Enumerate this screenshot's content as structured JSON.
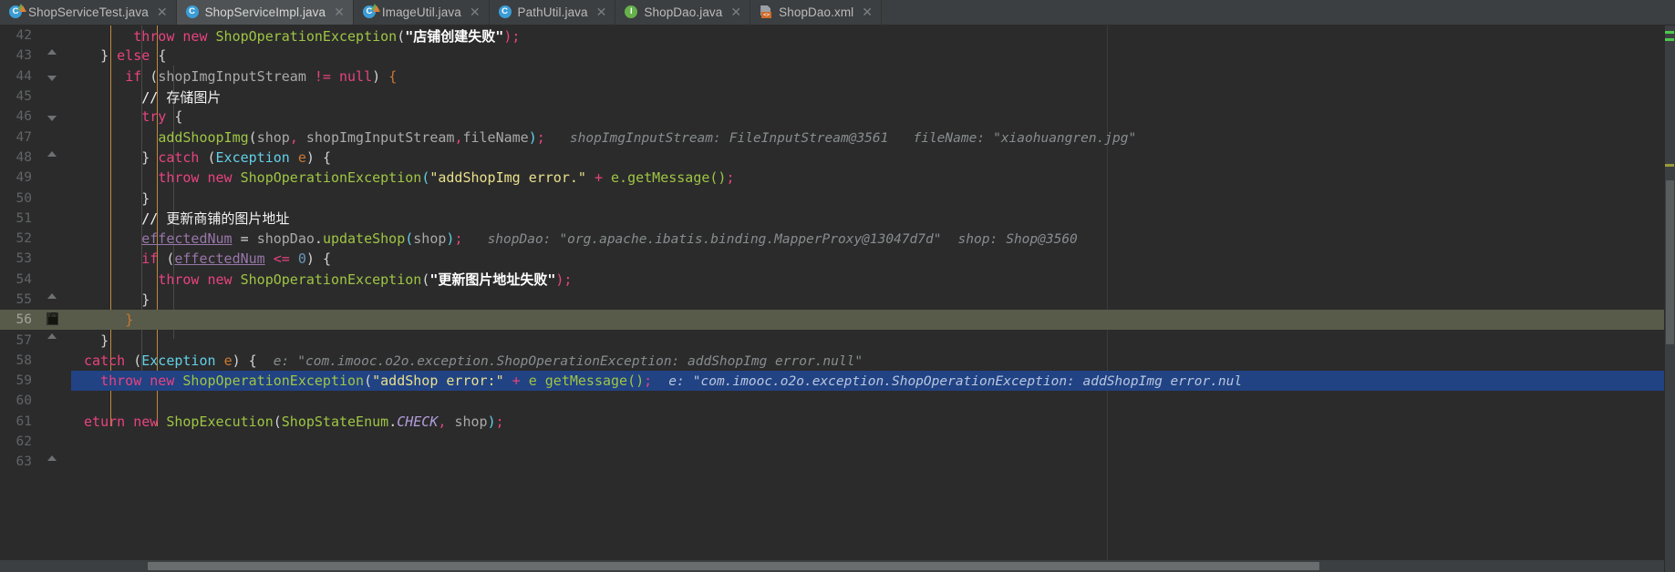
{
  "window": {
    "app": "IntelliJ IDEA",
    "theme_bg": "#2b2b2b",
    "tabbar_bg": "#3c3f41",
    "accent": "#214283",
    "current_line_bg": "#585b4a"
  },
  "tabbar": {
    "tabs": [
      {
        "label": "ShopServiceTest.java",
        "icon": "java-test-class-icon",
        "icon_letter": "C",
        "icon_color": "#3b9dd6",
        "active": false,
        "closable": true
      },
      {
        "label": "ShopServiceImpl.java",
        "icon": "java-class-icon",
        "icon_letter": "C",
        "icon_color": "#3b9dd6",
        "active": true,
        "closable": true
      },
      {
        "label": "ImageUtil.java",
        "icon": "java-test-class-icon",
        "icon_letter": "C",
        "icon_color": "#3b9dd6",
        "active": false,
        "closable": true
      },
      {
        "label": "PathUtil.java",
        "icon": "java-class-icon",
        "icon_letter": "C",
        "icon_color": "#3b9dd6",
        "active": false,
        "closable": true
      },
      {
        "label": "ShopDao.java",
        "icon": "java-interface-icon",
        "icon_letter": "I",
        "icon_color": "#66b14a",
        "active": false,
        "closable": true
      },
      {
        "label": "ShopDao.xml",
        "icon": "xml-file-icon",
        "icon_letter": "<>",
        "icon_color": "#cf6a29",
        "active": false,
        "closable": true
      }
    ],
    "close_glyph": "✕"
  },
  "editor": {
    "first_visible_line": 42,
    "last_visible_line": 63,
    "caret_line": 56,
    "selected_line": 59,
    "lines": [
      {
        "n": 42,
        "fold": "none",
        "indent": 3
      },
      {
        "n": 43,
        "fold": "up",
        "indent": 2
      },
      {
        "n": 44,
        "fold": "tri",
        "indent": 3
      },
      {
        "n": 45,
        "fold": "none",
        "indent": 4
      },
      {
        "n": 46,
        "fold": "tri",
        "indent": 4
      },
      {
        "n": 47,
        "fold": "none",
        "indent": 5
      },
      {
        "n": 48,
        "fold": "up",
        "indent": 4
      },
      {
        "n": 49,
        "fold": "none",
        "indent": 5
      },
      {
        "n": 50,
        "fold": "none",
        "indent": 4
      },
      {
        "n": 51,
        "fold": "none",
        "indent": 4
      },
      {
        "n": 52,
        "fold": "none",
        "indent": 4
      },
      {
        "n": 53,
        "fold": "none",
        "indent": 4
      },
      {
        "n": 54,
        "fold": "none",
        "indent": 5
      },
      {
        "n": 55,
        "fold": "up",
        "indent": 4
      },
      {
        "n": 56,
        "fold": "lock",
        "indent": 3
      },
      {
        "n": 57,
        "fold": "up",
        "indent": 2
      },
      {
        "n": 58,
        "fold": "none",
        "indent": 1
      },
      {
        "n": 59,
        "fold": "none",
        "indent": 2
      },
      {
        "n": 60,
        "fold": "none",
        "indent": 1
      },
      {
        "n": 61,
        "fold": "none",
        "indent": 1
      },
      {
        "n": 62,
        "fold": "none",
        "indent": 1
      },
      {
        "n": 63,
        "fold": "up",
        "indent": 1
      }
    ],
    "code": {
      "l42": {
        "throw": "throw",
        "new": "new",
        "exc": "ShopOperationException",
        "str": "\"店铺创建失败\""
      },
      "l43": {
        "text": "} else {"
      },
      "l44": {
        "if": "if",
        "var": "shopImgInputStream",
        "op": "!=",
        "null": "null"
      },
      "l45": {
        "comment": "// 存储图片"
      },
      "l46": {
        "try": "try"
      },
      "l47": {
        "method": "addShoopImg",
        "a1": "shop",
        "a2": "shopImgInputStream",
        "a3": "fileName",
        "hint1": "shopImgInputStream:",
        "hint1v": "FileInputStream@3561",
        "hint2": "fileName:",
        "hint2v": "\"xiaohuangren.jpg\""
      },
      "l48": {
        "catch": "catch",
        "type": "Exception",
        "param": "e"
      },
      "l49": {
        "throw": "throw",
        "new": "new",
        "exc": "ShopOperationException",
        "str": "\"addShopImg error.\"",
        "plus": "+",
        "call": "e.getMessage()"
      },
      "l50": {
        "text": "}"
      },
      "l51": {
        "comment": "// 更新商铺的图片地址"
      },
      "l52": {
        "field": "effectedNum",
        "eq": "=",
        "obj": "shopDao",
        "call": "updateShop",
        "arg": "shop",
        "hint1": "shopDao:",
        "hint1v": "\"org.apache.ibatis.binding.MapperProxy@13047d7d\"",
        "hint2": "shop:",
        "hint2v": "Shop@3560"
      },
      "l53": {
        "if": "if",
        "field": "effectedNum",
        "op": "<=",
        "num": "0"
      },
      "l54": {
        "throw": "throw",
        "new": "new",
        "exc": "ShopOperationException",
        "str": "\"更新图片地址失败\""
      },
      "l55": {
        "text": "}"
      },
      "l56": {
        "text": "}"
      },
      "l57": {
        "text": "}"
      },
      "l58": {
        "catch": "catch",
        "type": "Exception",
        "param": "e",
        "hint": "e:",
        "hintv": "\"com.imooc.o2o.exception.ShopOperationException: addShopImg error.null\""
      },
      "l59": {
        "throw": "throw",
        "new": "new",
        "exc": "ShopOperationException",
        "str": "\"addShop error:\"",
        "plus": "+",
        "call": "e getMessage()",
        "hint": "e:",
        "hintv": "\"com.imooc.o2o.exception.ShopOperationException: addShopImg error.nul"
      },
      "l61": {
        "return": "eturn",
        "new": "new",
        "exc": "ShopExecution",
        "enum": "ShopStateEnum",
        "const": "CHECK",
        "arg": "shop"
      }
    }
  },
  "scrollbars": {
    "vertical_thumb_top_pct": 28,
    "vertical_thumb_height_pct": 30,
    "horizontal_thumb_left_pct": 10,
    "horizontal_thumb_width_pct": 81,
    "markers": [
      {
        "color": "#4ec94e",
        "top_pct": 2
      },
      {
        "color": "#4ec94e",
        "top_pct": 4
      },
      {
        "color": "#9a9a3a",
        "top_pct": 25
      }
    ]
  }
}
